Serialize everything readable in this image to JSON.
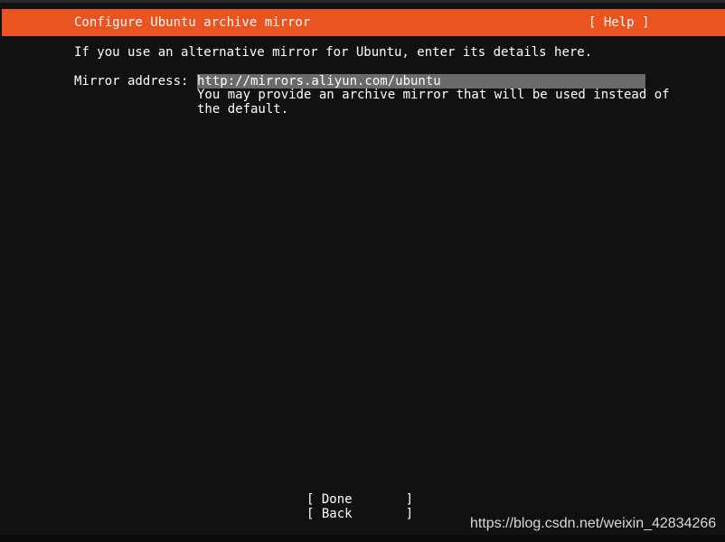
{
  "header": {
    "title": "Configure Ubuntu archive mirror",
    "help_label": "[ Help ]"
  },
  "main": {
    "intro": "If you use an alternative mirror for Ubuntu, enter its details here.",
    "mirror": {
      "label": "Mirror address:",
      "value": "http://mirrors.aliyun.com/ubuntu",
      "help_line1": "You may provide an archive mirror that will be used instead of",
      "help_line2": "the default."
    }
  },
  "buttons": {
    "done_label": "[ Done       ]",
    "back_label": "[ Back       ]"
  },
  "watermark": {
    "text": "https://blog.csdn.net/weixin_42834266"
  },
  "colors": {
    "accent": "#e95420",
    "background": "#111111",
    "input_highlight": "#6a6a6a"
  }
}
